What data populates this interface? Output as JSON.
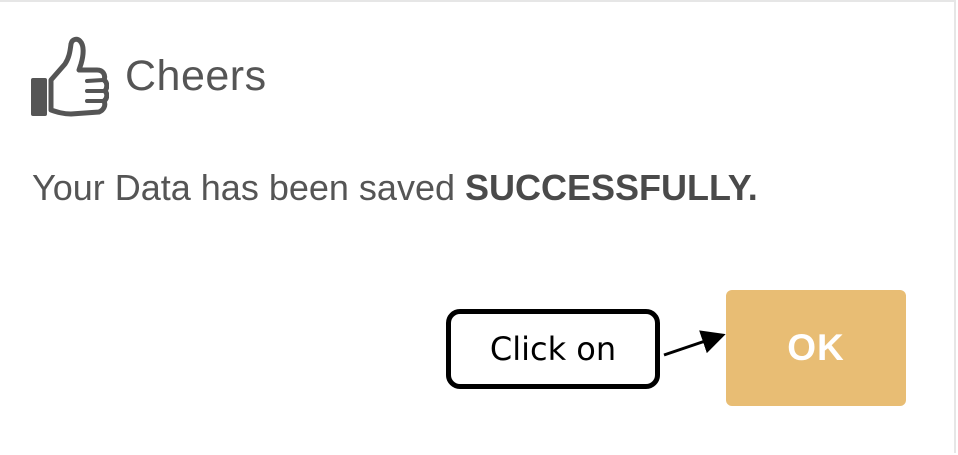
{
  "dialog": {
    "title": "Cheers",
    "icon": "thumbs-up-icon",
    "message_prefix": "Your Data has been saved ",
    "message_emphasis": "SUCCESSFULLY.",
    "ok_label": "OK"
  },
  "annotation": {
    "callout_text": "Click on"
  },
  "colors": {
    "ok_button": "#e8bd74",
    "ok_text": "#ffffff",
    "text": "#555555",
    "callout_border": "#000000"
  }
}
